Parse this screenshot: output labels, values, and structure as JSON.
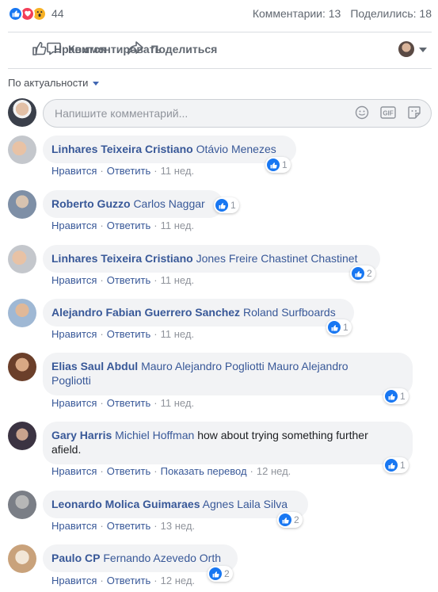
{
  "stats": {
    "reaction_count": "44",
    "comments_label": "Комментарии: 13",
    "shares_label": "Поделились: 18"
  },
  "actions": {
    "like_label": "Нравится",
    "comment_label": "Комментировать",
    "share_label": "Поделиться"
  },
  "sort": {
    "label": "По актуальности"
  },
  "composer": {
    "placeholder": "Напишите комментарий..."
  },
  "meta_labels": {
    "like": "Нравится",
    "reply": "Ответить",
    "translate": "Показать перевод"
  },
  "comments": [
    {
      "author": "Linhares Teixeira Cristiano",
      "mention": "Otávio Menezes",
      "text": "",
      "likes": "1",
      "time": "11 нед."
    },
    {
      "author": "Roberto Guzzo",
      "mention": "Carlos Naggar",
      "text": "",
      "likes": "1",
      "time": "11 нед."
    },
    {
      "author": "Linhares Teixeira Cristiano",
      "mention": "Jones Freire Chastinet Chastinet",
      "text": "",
      "likes": "2",
      "time": "11 нед."
    },
    {
      "author": "Alejandro Fabian Guerrero Sanchez",
      "mention": "Roland Surfboards",
      "text": "",
      "likes": "1",
      "time": "11 нед."
    },
    {
      "author": "Elias Saul Abdul",
      "mention": "Mauro Alejandro Pogliotti Mauro Alejandro",
      "mention2": "Pogliotti",
      "text": "",
      "likes": "1",
      "time": "11 нед."
    },
    {
      "author": "Gary Harris",
      "mention": "Michiel Hoffman",
      "text": "how about trying something further",
      "text2": "afield.",
      "likes": "1",
      "time": "12 нед."
    },
    {
      "author": "Leonardo Molica Guimaraes",
      "mention": "Agnes Laila Silva",
      "text": "",
      "likes": "2",
      "time": "13 нед."
    },
    {
      "author": "Paulo CP",
      "mention": "Fernando Azevedo Orth",
      "text": "",
      "likes": "2",
      "time": "12 нед."
    }
  ],
  "colors": {
    "link": "#385898",
    "like_blue": "#1877f2",
    "love_red": "#f33e58",
    "wow_yellow": "#f7b125",
    "bubble_bg": "#f2f3f5",
    "meta_gray": "#90949c"
  },
  "icons": {
    "reactions": [
      "like-reaction-icon",
      "love-reaction-icon",
      "wow-reaction-icon"
    ],
    "actions": [
      "thumbs-up-icon",
      "speech-bubble-icon",
      "share-arrow-icon",
      "chevron-down-icon"
    ],
    "composer": [
      "emoji-icon",
      "gif-icon",
      "sticker-icon"
    ]
  }
}
